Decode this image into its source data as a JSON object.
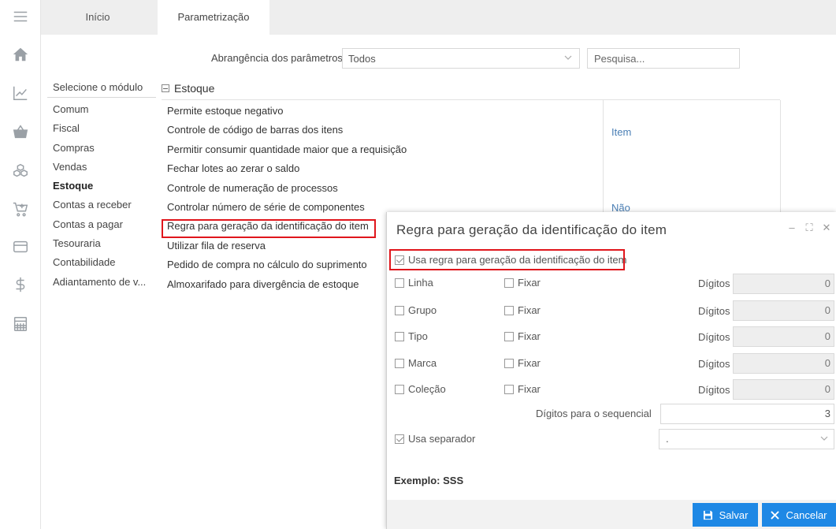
{
  "tabs": [
    "Início",
    "Parametrização"
  ],
  "filter": {
    "label": "Abrangência dos parâmetros",
    "scope_value": "Todos",
    "search_placeholder": "Pesquisa..."
  },
  "modules": {
    "header": "Selecione o módulo",
    "items": [
      "Comum",
      "Fiscal",
      "Compras",
      "Vendas",
      "Estoque",
      "Contas a receber",
      "Contas a pagar",
      "Tesouraria",
      "Contabilidade",
      "Adiantamento de v..."
    ],
    "active": "Estoque"
  },
  "section": {
    "title": "Estoque",
    "params": [
      "Permite estoque negativo",
      "Controle de código de barras dos itens",
      "Permitir consumir quantidade maior que a requisição",
      "Fechar lotes ao zerar o saldo",
      "Controle de numeração de processos",
      "Controlar número de série de componentes",
      "Regra para geração da identificação do item",
      "Utilizar fila de reserva",
      "Pedido de compra no cálculo do suprimento",
      "Almoxarifado para divergência de estoque"
    ],
    "values": {
      "barcode": "Item",
      "serial": "Não"
    }
  },
  "modal": {
    "title": "Regra para geração da identificação do item",
    "use_rule_label": "Usa regra para geração da identificação do item",
    "use_rule_checked": true,
    "rows": [
      {
        "label": "Linha",
        "fix": "Fixar",
        "digits_label": "Dígitos",
        "digits": "0"
      },
      {
        "label": "Grupo",
        "fix": "Fixar",
        "digits_label": "Dígitos",
        "digits": "0"
      },
      {
        "label": "Tipo",
        "fix": "Fixar",
        "digits_label": "Dígitos",
        "digits": "0"
      },
      {
        "label": "Marca",
        "fix": "Fixar",
        "digits_label": "Dígitos",
        "digits": "0"
      },
      {
        "label": "Coleção",
        "fix": "Fixar",
        "digits_label": "Dígitos",
        "digits": "0"
      }
    ],
    "sequential_label": "Dígitos para o sequencial",
    "sequential_value": "3",
    "separator_label": "Usa separador",
    "separator_checked": true,
    "separator_value": ".",
    "example": "Exemplo: SSS",
    "save": "Salvar",
    "cancel": "Cancelar"
  },
  "colors": {
    "accent": "#1e88e5",
    "highlight": "#e0161c",
    "link": "#4a7fb5"
  }
}
